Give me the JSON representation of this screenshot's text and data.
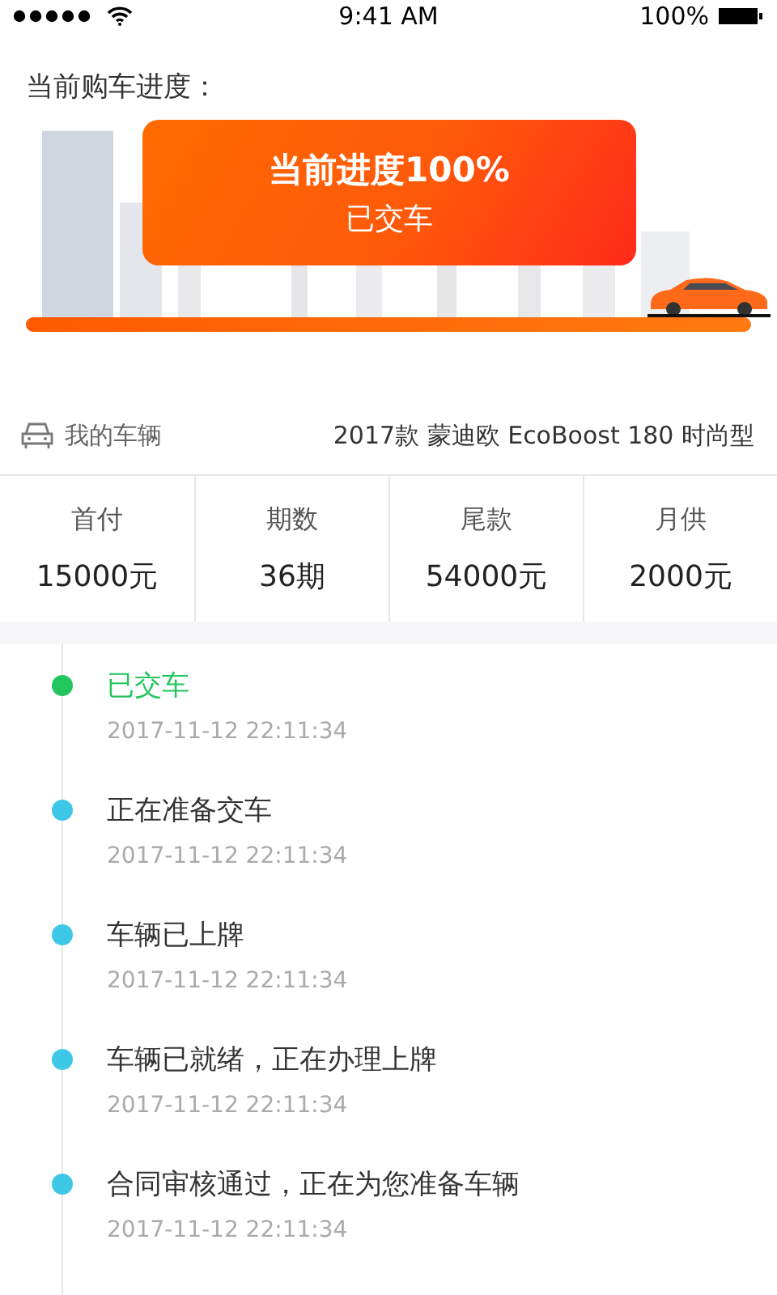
{
  "status_bar": {
    "time": "9:41 AM",
    "battery": "100%"
  },
  "progress": {
    "title": "当前购车进度：",
    "headline": "当前进度100%",
    "stage": "已交车",
    "level": 1
  },
  "vehicle": {
    "label": "我的车辆",
    "model": "2017款 蒙迪欧 EcoBoost 180 时尚型"
  },
  "stats": [
    {
      "label": "首付",
      "value": "15000元"
    },
    {
      "label": "期数",
      "value": "36期"
    },
    {
      "label": "尾款",
      "value": "54000元"
    },
    {
      "label": "月供",
      "value": "2000元"
    }
  ],
  "timeline": [
    {
      "title": "已交车",
      "time": "2017-11-12 22:11:34",
      "color": "#22c55e",
      "current": true
    },
    {
      "title": "正在准备交车",
      "time": "2017-11-12 22:11:34",
      "color": "#3ec8e8",
      "current": false
    },
    {
      "title": "车辆已上牌",
      "time": "2017-11-12 22:11:34",
      "color": "#3ec8e8",
      "current": false
    },
    {
      "title": "车辆已就绪，正在办理上牌",
      "time": "2017-11-12 22:11:34",
      "color": "#3ec8e8",
      "current": false
    },
    {
      "title": "合同审核通过，正在为您准备车辆",
      "time": "2017-11-12 22:11:34",
      "color": "#3ec8e8",
      "current": false
    }
  ]
}
